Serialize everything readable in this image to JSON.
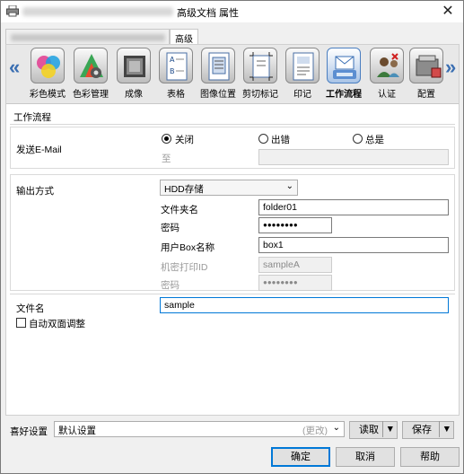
{
  "window": {
    "title": "高级文档 属性",
    "close_glyph": "✕"
  },
  "tabs": [
    {
      "label": ""
    },
    {
      "label": "高级"
    }
  ],
  "functions": [
    {
      "label": "彩色模式",
      "icon": "color-mode-icon"
    },
    {
      "label": "色彩管理",
      "icon": "color-management-icon"
    },
    {
      "label": "成像",
      "icon": "imaging-icon"
    },
    {
      "label": "表格",
      "icon": "form-icon"
    },
    {
      "label": "图像位置",
      "icon": "image-position-icon"
    },
    {
      "label": "剪切标记",
      "icon": "crop-mark-icon"
    },
    {
      "label": "印记",
      "icon": "stamp-icon"
    },
    {
      "label": "工作流程",
      "icon": "workflow-icon",
      "selected": true
    },
    {
      "label": "认证",
      "icon": "authentication-icon"
    },
    {
      "label": "配置",
      "icon": "configuration-icon"
    }
  ],
  "workflow": {
    "section_title": "工作流程",
    "send_email_label": "发送E-Mail",
    "radio_options": [
      "关闭",
      "出错",
      "总是"
    ],
    "radio_selected": "关闭",
    "to_label": "至",
    "to_value": "",
    "output_label": "输出方式",
    "output_value": "HDD存储",
    "folder_label": "文件夹名",
    "folder_value": "folder01",
    "password_label": "密码",
    "password_value": "●●●●●●●●",
    "user_box_label": "用户Box名称",
    "user_box_value": "box1",
    "secure_print_id_label": "机密打印ID",
    "secure_print_id_value": "sampleA",
    "secure_password_label": "密码",
    "secure_password_value": "●●●●●●●●",
    "filename_label": "文件名",
    "filename_value": "sample",
    "auto_duplex_label": "自动双面调整"
  },
  "favorites": {
    "label": "喜好设置",
    "value": "默认设置",
    "changed": "(更改)",
    "read_label": "读取",
    "save_label": "保存"
  },
  "buttons": {
    "ok": "确定",
    "cancel": "取消",
    "help": "帮助"
  },
  "colors": {
    "accent": "#0078d7",
    "arrow_blue": "#3b6fb2"
  }
}
